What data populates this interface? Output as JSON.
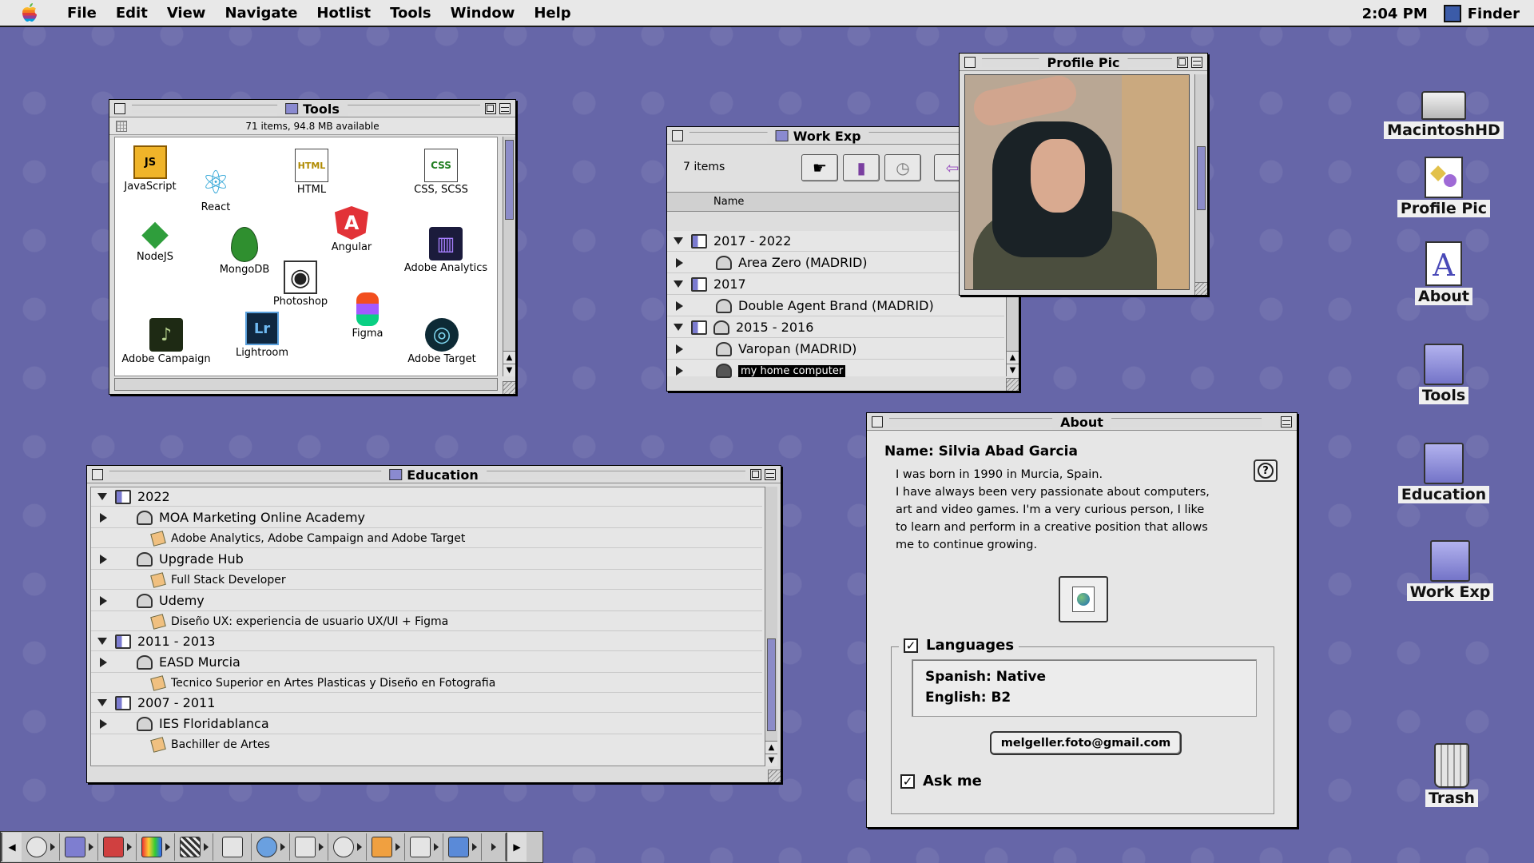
{
  "menubar": {
    "items": [
      "File",
      "Edit",
      "View",
      "Navigate",
      "Hotlist",
      "Tools",
      "Window",
      "Help"
    ],
    "clock": "2:04 PM",
    "app": "Finder"
  },
  "tools_window": {
    "title": "Tools",
    "info": "71 items, 94.8 MB available",
    "icons": [
      {
        "label": "JavaScript",
        "glyph": "JS",
        "color": "#f0b429"
      },
      {
        "label": "React",
        "glyph": "⚛",
        "color": "#36a8d8"
      },
      {
        "label": "HTML",
        "glyph": "HTML",
        "color": "#f5c400"
      },
      {
        "label": "CSS, SCSS",
        "glyph": "CSS",
        "color": "#e8d200"
      },
      {
        "label": "NodeJS",
        "glyph": "◆",
        "color": "#2f9e3c"
      },
      {
        "label": "MongoDB",
        "glyph": "●",
        "color": "#2f8f2f"
      },
      {
        "label": "Angular",
        "glyph": "A",
        "color": "#e23237"
      },
      {
        "label": "Adobe Analytics",
        "glyph": "▥",
        "color": "#1b1b3c"
      },
      {
        "label": "Photoshop",
        "glyph": "◉",
        "color": "#222222"
      },
      {
        "label": "Figma",
        "glyph": "✿",
        "color": "#f24e1e"
      },
      {
        "label": "Adobe Campaign",
        "glyph": "♪",
        "color": "#2b3a1f"
      },
      {
        "label": "Lightroom",
        "glyph": "Lr",
        "color": "#0f2740"
      },
      {
        "label": "Adobe Target",
        "glyph": "◎",
        "color": "#0d2a35"
      }
    ]
  },
  "workexp_window": {
    "title": "Work Exp",
    "count": "7 items",
    "column": "Name",
    "rows": [
      {
        "label": "2017 - 2022",
        "type": "group",
        "open": true
      },
      {
        "label": "Area Zero (MADRID)",
        "type": "item"
      },
      {
        "label": "2017",
        "type": "group",
        "open": true
      },
      {
        "label": "Double Agent Brand (MADRID)",
        "type": "item"
      },
      {
        "label": "2015 - 2016",
        "type": "group",
        "open": true
      },
      {
        "label": "Varopan (MADRID)",
        "type": "item"
      },
      {
        "label": "my home computer",
        "type": "item",
        "selected": true
      }
    ]
  },
  "profile_window": {
    "title": "Profile Pic"
  },
  "education_window": {
    "title": "Education",
    "rows": [
      {
        "label": "2022",
        "type": "group"
      },
      {
        "label": "MOA Marketing Online Academy",
        "type": "item"
      },
      {
        "label": "Adobe Analytics, Adobe Campaign and Adobe Target",
        "type": "sub"
      },
      {
        "label": "Upgrade Hub",
        "type": "item"
      },
      {
        "label": "Full Stack Developer",
        "type": "sub"
      },
      {
        "label": "Udemy",
        "type": "item"
      },
      {
        "label": "Diseño UX: experiencia de usuario UX/UI + Figma",
        "type": "sub"
      },
      {
        "label": "2011 - 2013",
        "type": "group"
      },
      {
        "label": "EASD Murcia",
        "type": "item"
      },
      {
        "label": "Tecnico Superior en Artes Plasticas y Diseño en Fotografia",
        "type": "sub"
      },
      {
        "label": "2007 - 2011",
        "type": "group"
      },
      {
        "label": "IES Floridablanca",
        "type": "item"
      },
      {
        "label": "Bachiller de Artes",
        "type": "sub"
      }
    ]
  },
  "about_window": {
    "title": "About",
    "name": "Name: Silvia Abad Garcia",
    "bio": [
      "I was born in 1990 in Murcia, Spain.",
      "I have always been very passionate about computers,",
      "art and video games.  I'm a very curious person, I like",
      "to learn and perform in a creative position that allows",
      "me to continue growing."
    ],
    "languages_label": "Languages",
    "languages": [
      "Spanish: Native",
      "English: B2"
    ],
    "email": "melgeller.foto@gmail.com",
    "ask_me": "Ask me"
  },
  "desktop_icons": [
    {
      "label": "MacintoshHD",
      "kind": "hard-drive"
    },
    {
      "label": "Profile Pic",
      "kind": "image-file"
    },
    {
      "label": "About",
      "kind": "text-file"
    },
    {
      "label": "Tools",
      "kind": "folder"
    },
    {
      "label": "Education",
      "kind": "folder"
    },
    {
      "label": "Work Exp",
      "kind": "folder"
    },
    {
      "label": "Trash",
      "kind": "trash"
    }
  ],
  "control_strip": {
    "modules": [
      "cd-icon",
      "folder-icon",
      "appletalk-icon",
      "monitor-depth-icon",
      "bit-depth-icon",
      "display-icon",
      "search-icon",
      "sound-icon",
      "speech-icon",
      "tools-icon",
      "printer-icon",
      "music-icon",
      "arrow-icon"
    ]
  },
  "colors": {
    "desktop": "#6666a8",
    "window": "#dddddd",
    "selection": "#000000"
  }
}
